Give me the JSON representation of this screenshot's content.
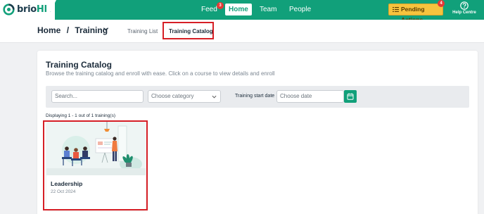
{
  "brand": {
    "name_main": "brio",
    "name_suffix": "HR",
    "accent": "#11a07a",
    "highlight": "#d61f26"
  },
  "nav": {
    "items": [
      {
        "label": "Feed",
        "badge": "3"
      },
      {
        "label": "Home"
      },
      {
        "label": "Team"
      },
      {
        "label": "People"
      }
    ],
    "pending": {
      "label": "Pending Actions",
      "badge": "4"
    },
    "help": {
      "label": "Help Centre"
    }
  },
  "breadcrumb": {
    "root": "Home",
    "sep": "/",
    "current": "Training"
  },
  "tabs": [
    {
      "label": "Training List"
    },
    {
      "label": "Training Catalog"
    }
  ],
  "catalog": {
    "title": "Training Catalog",
    "description": "Browse the training catalog and enroll with ease. Click on a course to view details and enroll",
    "filters": {
      "search_placeholder": "Search...",
      "category_placeholder": "Choose category",
      "date_label": "Training start date",
      "date_placeholder": "Choose date"
    },
    "showing": "Displaying 1 - 1 out of 1 training(s)",
    "courses": [
      {
        "name": "Leadership",
        "date": "22 Oct 2024"
      }
    ]
  }
}
